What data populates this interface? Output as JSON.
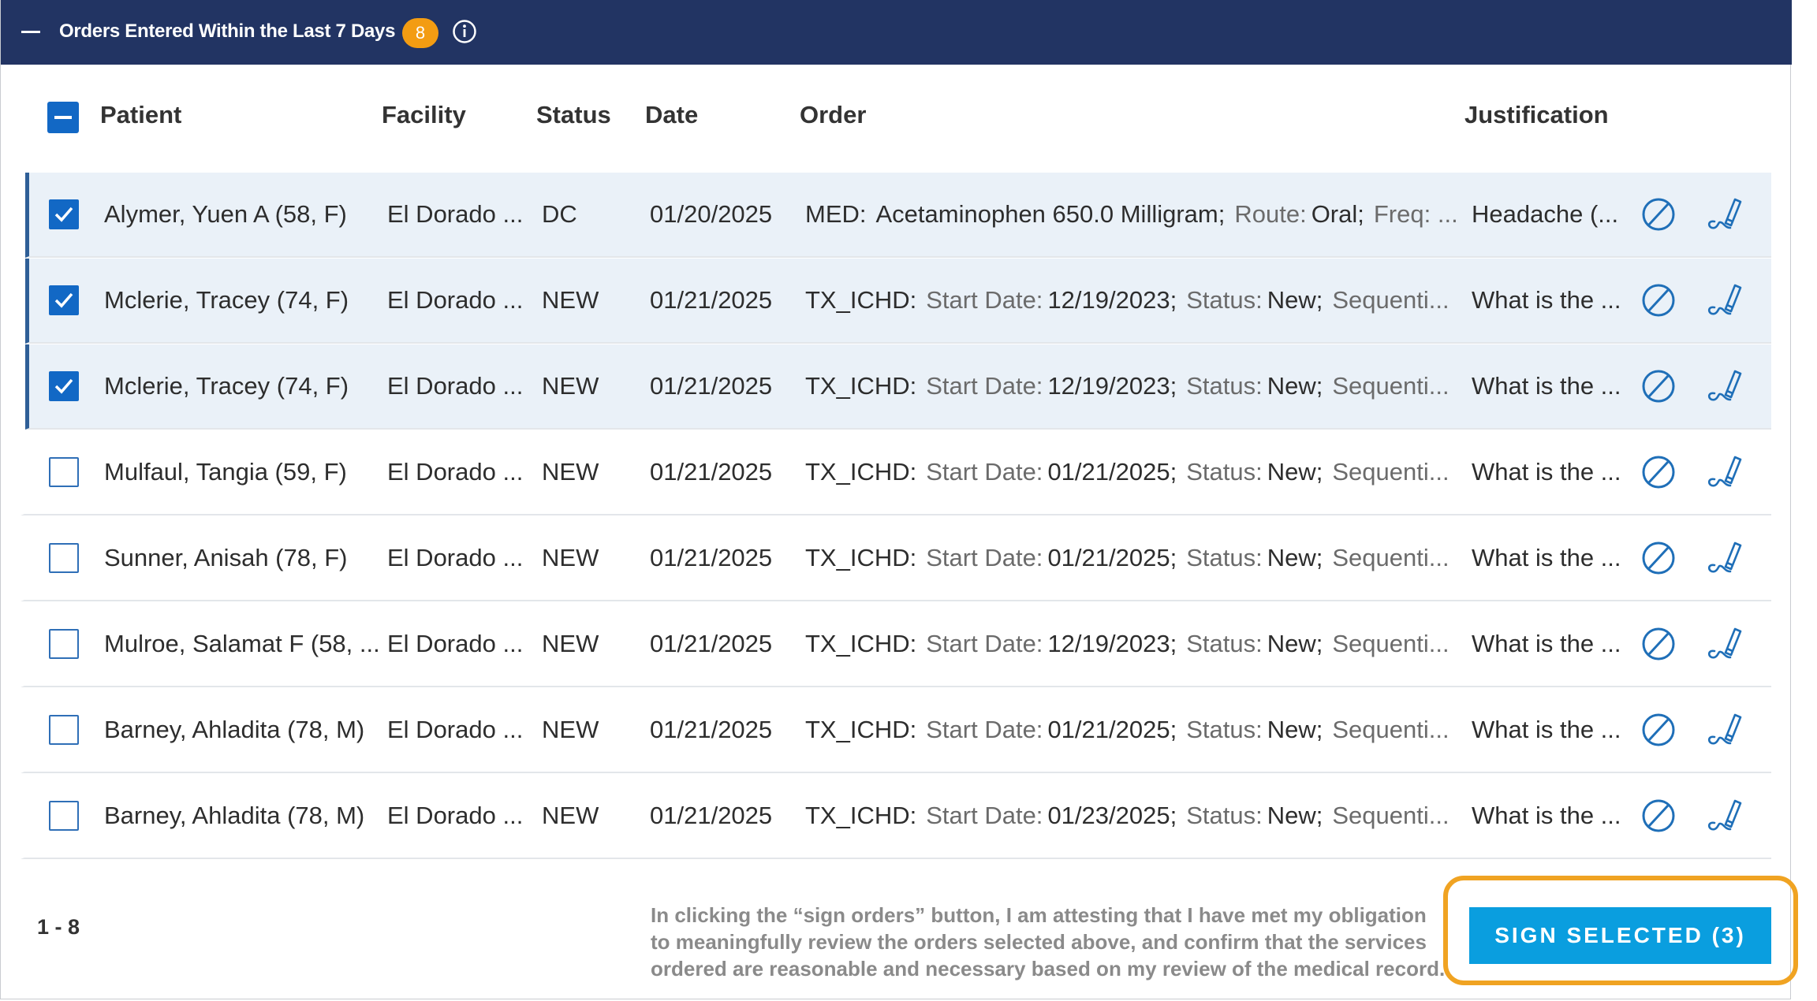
{
  "header": {
    "title": "Orders Entered Within the Last 7 Days",
    "count": "8"
  },
  "columns": {
    "patient": "Patient",
    "facility": "Facility",
    "status": "Status",
    "date": "Date",
    "order": "Order",
    "justification": "Justification"
  },
  "rows": [
    {
      "selected": true,
      "patient": "Alymer, Yuen A (58, F)",
      "facility": "El Dorado ...",
      "status": "DC",
      "date": "01/20/2025",
      "order_type": "MED:",
      "order_parts": [
        {
          "label": "",
          "value": "Acetaminophen 650.0 Milligram;"
        },
        {
          "label": "Route:",
          "value": "Oral;"
        },
        {
          "label": "Freq: ...",
          "value": ""
        }
      ],
      "justification": "Headache (..."
    },
    {
      "selected": true,
      "patient": "Mclerie, Tracey (74, F)",
      "facility": "El Dorado ...",
      "status": "NEW",
      "date": "01/21/2025",
      "order_type": "TX_ICHD:",
      "order_parts": [
        {
          "label": "Start Date:",
          "value": "12/19/2023;"
        },
        {
          "label": "Status:",
          "value": "New;"
        },
        {
          "label": "Sequenti...",
          "value": ""
        }
      ],
      "justification": "What is the ..."
    },
    {
      "selected": true,
      "patient": "Mclerie, Tracey (74, F)",
      "facility": "El Dorado ...",
      "status": "NEW",
      "date": "01/21/2025",
      "order_type": "TX_ICHD:",
      "order_parts": [
        {
          "label": "Start Date:",
          "value": "12/19/2023;"
        },
        {
          "label": "Status:",
          "value": "New;"
        },
        {
          "label": "Sequenti...",
          "value": ""
        }
      ],
      "justification": "What is the ..."
    },
    {
      "selected": false,
      "patient": "Mulfaul, Tangia (59, F)",
      "facility": "El Dorado ...",
      "status": "NEW",
      "date": "01/21/2025",
      "order_type": "TX_ICHD:",
      "order_parts": [
        {
          "label": "Start Date:",
          "value": "01/21/2025;"
        },
        {
          "label": "Status:",
          "value": "New;"
        },
        {
          "label": "Sequenti...",
          "value": ""
        }
      ],
      "justification": "What is the ..."
    },
    {
      "selected": false,
      "patient": "Sunner, Anisah (78, F)",
      "facility": "El Dorado ...",
      "status": "NEW",
      "date": "01/21/2025",
      "order_type": "TX_ICHD:",
      "order_parts": [
        {
          "label": "Start Date:",
          "value": "01/21/2025;"
        },
        {
          "label": "Status:",
          "value": "New;"
        },
        {
          "label": "Sequenti...",
          "value": ""
        }
      ],
      "justification": "What is the ..."
    },
    {
      "selected": false,
      "patient": "Mulroe, Salamat F (58, ...",
      "facility": "El Dorado ...",
      "status": "NEW",
      "date": "01/21/2025",
      "order_type": "TX_ICHD:",
      "order_parts": [
        {
          "label": "Start Date:",
          "value": "12/19/2023;"
        },
        {
          "label": "Status:",
          "value": "New;"
        },
        {
          "label": "Sequenti...",
          "value": ""
        }
      ],
      "justification": "What is the ..."
    },
    {
      "selected": false,
      "patient": "Barney, Ahladita (78, M)",
      "facility": "El Dorado ...",
      "status": "NEW",
      "date": "01/21/2025",
      "order_type": "TX_ICHD:",
      "order_parts": [
        {
          "label": "Start Date:",
          "value": "01/21/2025;"
        },
        {
          "label": "Status:",
          "value": "New;"
        },
        {
          "label": "Sequenti...",
          "value": ""
        }
      ],
      "justification": "What is the ..."
    },
    {
      "selected": false,
      "patient": "Barney, Ahladita (78, M)",
      "facility": "El Dorado ...",
      "status": "NEW",
      "date": "01/21/2025",
      "order_type": "TX_ICHD:",
      "order_parts": [
        {
          "label": "Start Date:",
          "value": "01/23/2025;"
        },
        {
          "label": "Status:",
          "value": "New;"
        },
        {
          "label": "Sequenti...",
          "value": ""
        }
      ],
      "justification": "What is the ..."
    }
  ],
  "footer": {
    "pager": "1 - 8",
    "attestation_lines": [
      "In clicking the “sign orders” button, I am attesting that I have met my obligation",
      "to meaningfully review the orders selected above, and confirm that the services",
      "ordered are reasonable and necessary based on my review of the medical record."
    ],
    "sign_button": "SIGN SELECTED (3)"
  },
  "icons": {
    "collapse": "minus-icon",
    "info": "info-icon",
    "discontinue": "cancel-circle-icon",
    "sign": "sign-pen-icon"
  },
  "colors": {
    "header_bg": "#223463",
    "badge": "#f39c12",
    "checkbox": "#1268c5",
    "row_selected_bg": "#eaf1f8",
    "sign_button": "#0a9edf",
    "highlight_outline": "#f0a322"
  }
}
